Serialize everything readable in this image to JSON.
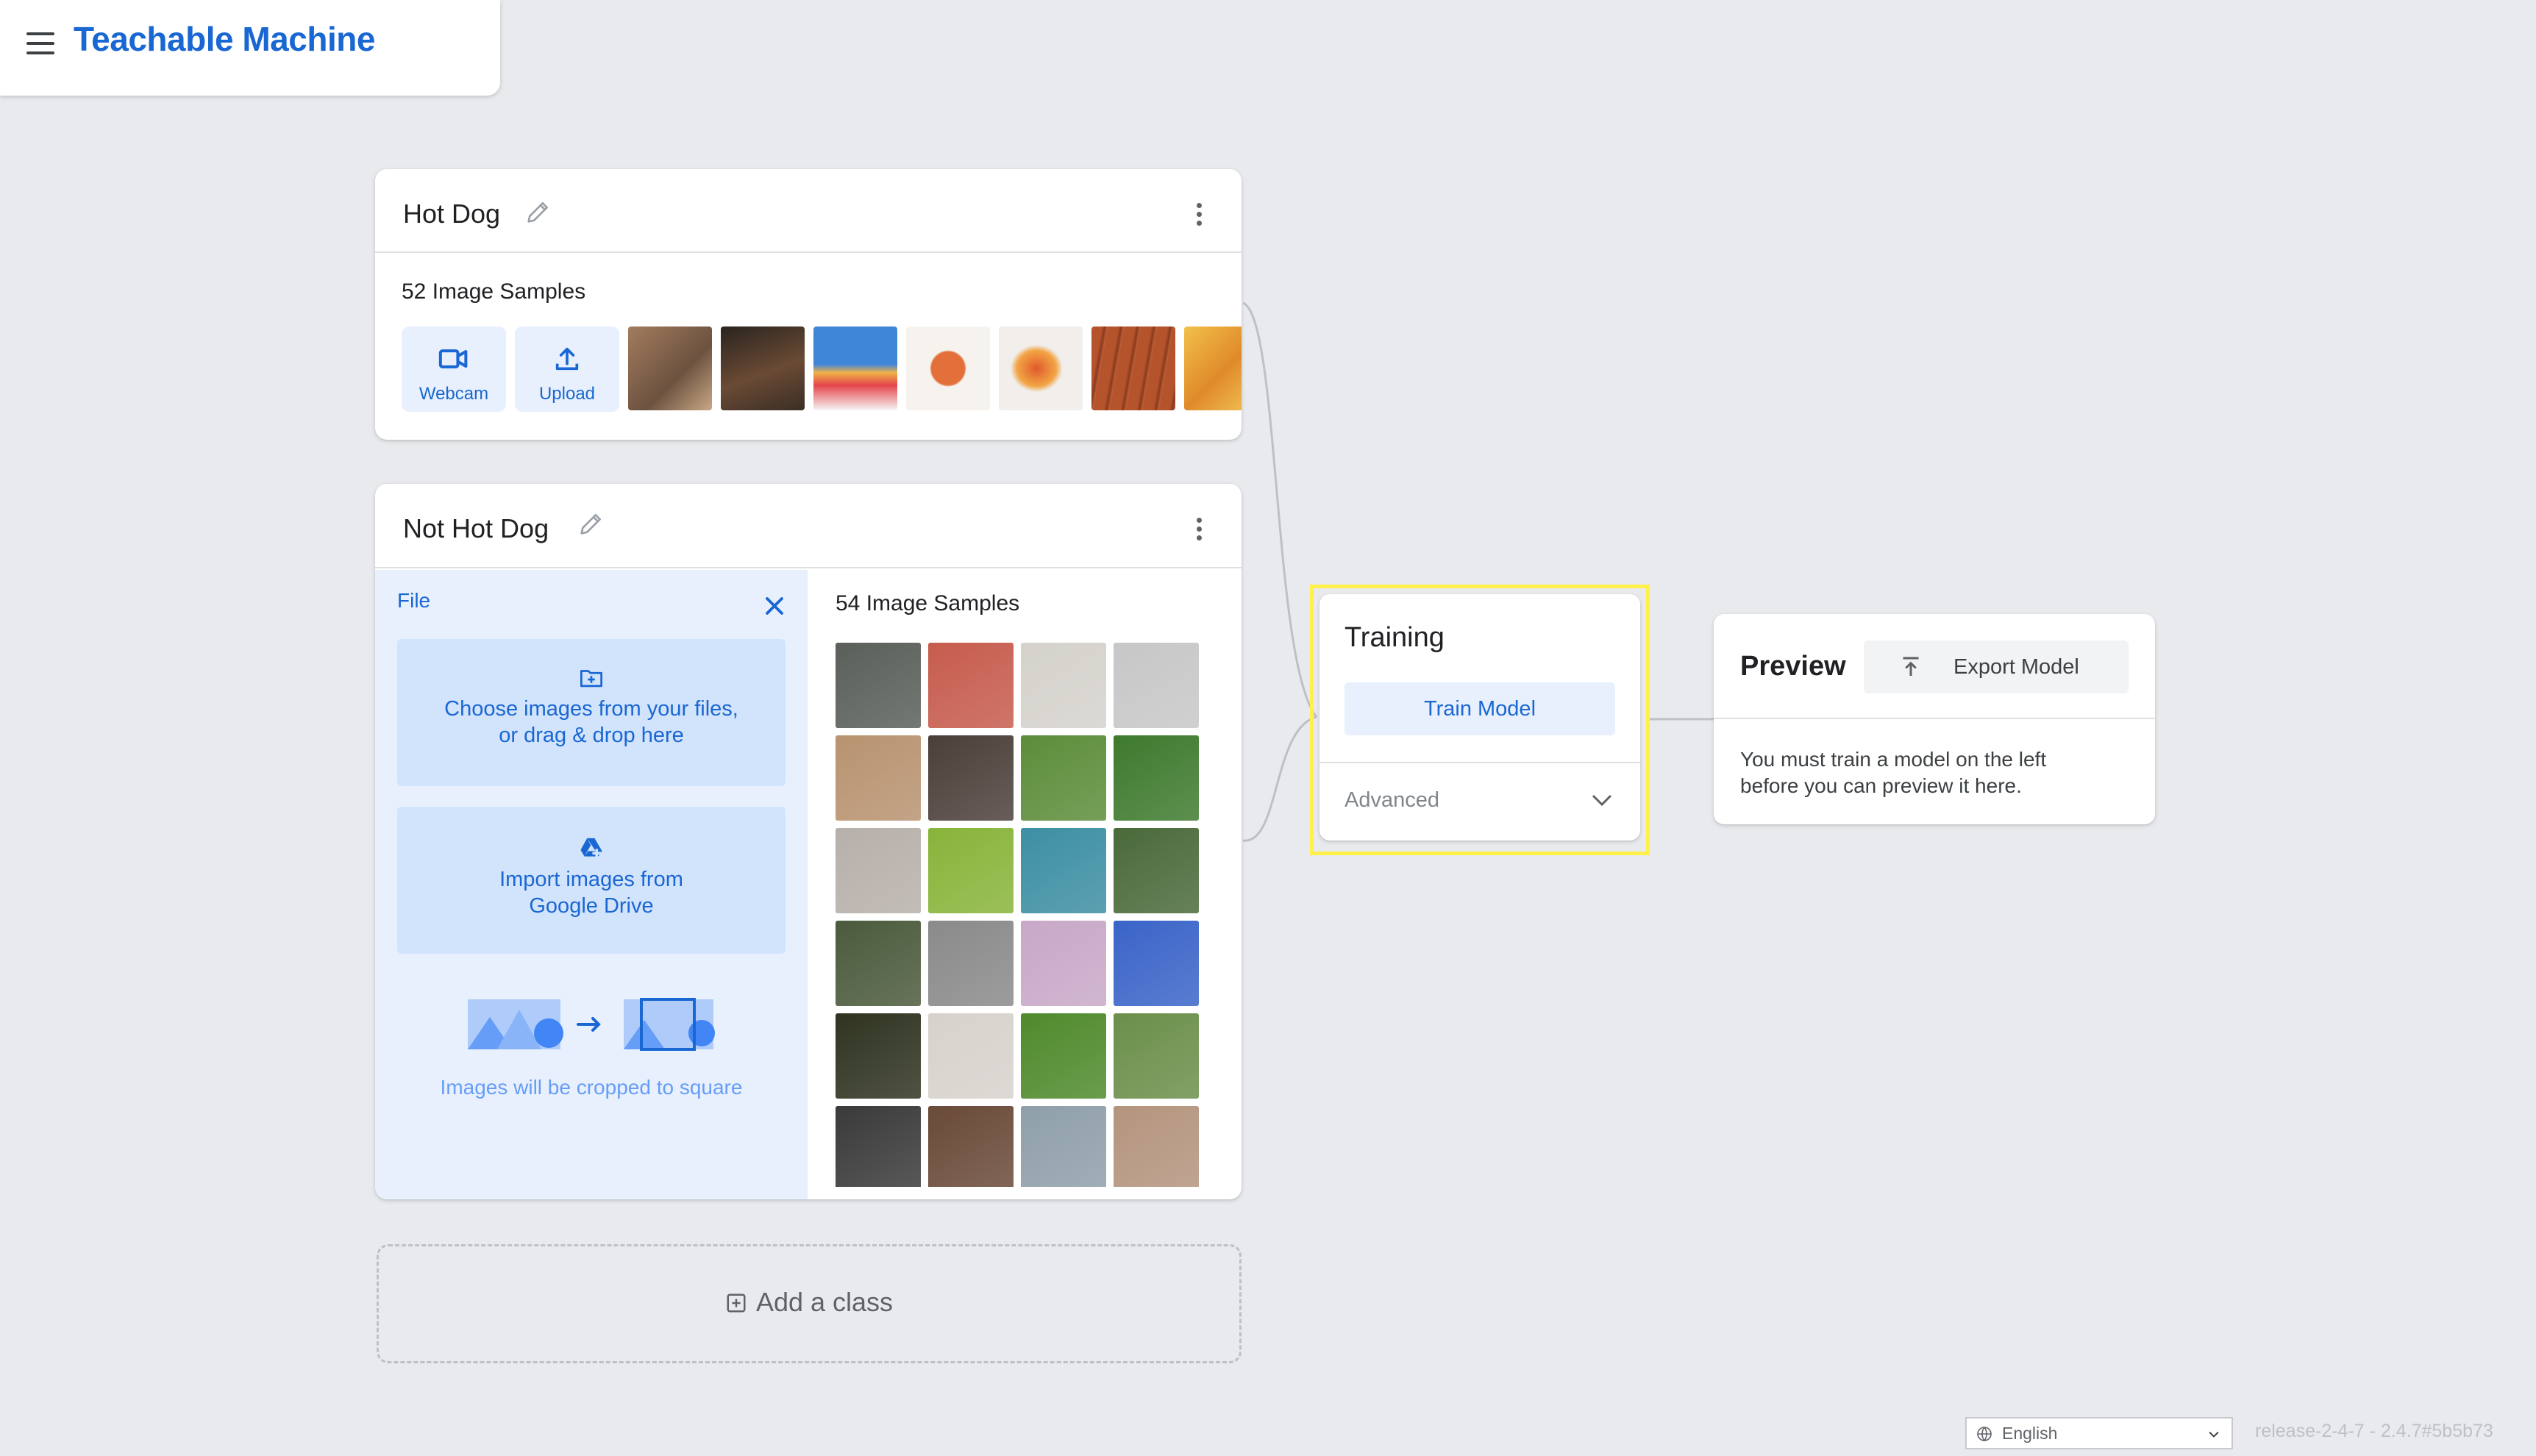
{
  "header": {
    "app_title": "Teachable Machine",
    "menu_icon": "menu-icon"
  },
  "classes": [
    {
      "name": "Hot Dog",
      "samples_label": "52 Image Samples",
      "webcam_label": "Webcam",
      "upload_label": "Upload",
      "thumbnail_colors": [
        "#8b6e56",
        "#4a3a2e",
        "#3f86d8",
        "#f3efe9",
        "#e9e5e2",
        "#b5532d",
        "#e0a330"
      ]
    },
    {
      "name": "Not Hot Dog",
      "samples_label": "54 Image Samples",
      "file_panel": {
        "label": "File",
        "choose_line1": "Choose images from your files,",
        "choose_line2": "or drag & drop here",
        "drive_line1": "Import images from",
        "drive_line2": "Google Drive",
        "crop_note": "Images will be cropped to square"
      },
      "grid_colors": [
        "#5a5f5a",
        "#c65c4e",
        "#d5d2cc",
        "#c7c7c7",
        "#b89370",
        "#4c3f3a",
        "#5c8d3a",
        "#3e7a2e",
        "#b7b0aa",
        "#88b43a",
        "#3d8fa3",
        "#4a6a3a",
        "#4b5a3c",
        "#8a8a8a",
        "#c8a8c8",
        "#3a64c8",
        "#2f3320",
        "#d6d2cc",
        "#4f8a2c",
        "#6b8f4a",
        "#3a3a3a",
        "#6a4a38",
        "#8f9faa",
        "#b4947e"
      ]
    }
  ],
  "add_class_label": "Add a class",
  "training": {
    "title": "Training",
    "train_button": "Train Model",
    "advanced_label": "Advanced"
  },
  "preview": {
    "title": "Preview",
    "export_button": "Export Model",
    "message_line1": "You must train a model on the left",
    "message_line2": "before you can preview it here."
  },
  "footer": {
    "language": "English",
    "version": "release-2-4-7 - 2.4.7#5b5b73"
  },
  "colors": {
    "accent": "#1967d2",
    "highlight": "#fff14a",
    "background": "#e8eaed"
  }
}
